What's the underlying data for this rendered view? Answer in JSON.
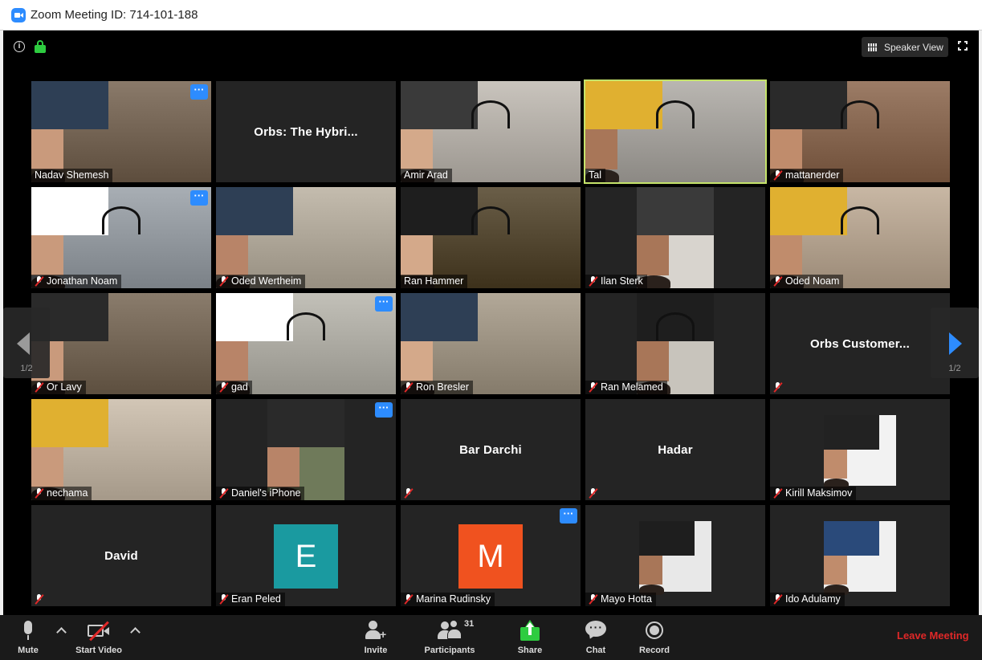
{
  "window": {
    "title": "Zoom Meeting ID: 714-101-188"
  },
  "top_bar": {
    "speaker_view_label": "Speaker View"
  },
  "nav": {
    "prev_page": "1/2",
    "next_page": "1/2"
  },
  "toolbar": {
    "mute_label": "Mute",
    "start_video_label": "Start Video",
    "invite_label": "Invite",
    "participants_label": "Participants",
    "participants_count": "31",
    "share_label": "Share",
    "chat_label": "Chat",
    "record_label": "Record",
    "leave_label": "Leave Meeting"
  },
  "tiles": [
    {
      "name": "Nadav Shemesh",
      "muted": false,
      "more": true,
      "kind": "video",
      "bg": "#8a7a6a"
    },
    {
      "name": "",
      "center": "Orbs:  The  Hybri...",
      "muted": false,
      "kind": "text"
    },
    {
      "name": "Amir Arad",
      "muted": false,
      "kind": "video",
      "bg": "#c9c4bd"
    },
    {
      "name": "Tal",
      "muted": false,
      "active": true,
      "kind": "video",
      "bg": "#b9b6b1"
    },
    {
      "name": "mattanerder",
      "muted": true,
      "kind": "video",
      "bg": "#9c7c66"
    },
    {
      "name": "Jonathan Noam",
      "muted": true,
      "more": true,
      "kind": "video",
      "bg": "#a8aeb4"
    },
    {
      "name": "Oded Wertheim",
      "muted": true,
      "kind": "video",
      "bg": "#c4bcae"
    },
    {
      "name": "Ran Hammer",
      "muted": false,
      "kind": "video",
      "bg": "#6a5e48"
    },
    {
      "name": "Ilan Sterk",
      "muted": true,
      "kind": "video",
      "bg": "#d8d4ce",
      "pillar": true
    },
    {
      "name": "Oded Noam",
      "muted": true,
      "kind": "video",
      "bg": "#c8b7a4"
    },
    {
      "name": "Or Lavy",
      "muted": true,
      "kind": "video",
      "bg": "#8a7c6c"
    },
    {
      "name": "gad",
      "muted": true,
      "more": true,
      "kind": "video",
      "bg": "#c2c0b8"
    },
    {
      "name": "Ron Bresler",
      "muted": true,
      "kind": "video",
      "bg": "#b2a898"
    },
    {
      "name": "Ran Melamed",
      "muted": true,
      "kind": "video",
      "bg": "#c8c4bc",
      "pillar": true
    },
    {
      "name": "",
      "center": "Orbs  Customer...",
      "muted": true,
      "kind": "text"
    },
    {
      "name": "nechama",
      "muted": true,
      "kind": "video",
      "bg": "#d2c6b6"
    },
    {
      "name": "Daniel's iPhone",
      "muted": true,
      "more": true,
      "kind": "video",
      "bg": "#6f7a5a",
      "pillar": true
    },
    {
      "name": "",
      "center": "Bar Darchi",
      "muted": true,
      "kind": "text"
    },
    {
      "name": "",
      "center": "Hadar",
      "muted": true,
      "kind": "text"
    },
    {
      "name": "Kirill Maksimov",
      "muted": true,
      "kind": "photo",
      "bg": "#f2f2f2"
    },
    {
      "name": "",
      "center": "David",
      "muted": true,
      "kind": "text"
    },
    {
      "name": "Eran Peled",
      "muted": true,
      "kind": "avatar",
      "letter": "E",
      "color": "#1a9aa0"
    },
    {
      "name": "Marina Rudinsky",
      "muted": true,
      "more": true,
      "kind": "avatar",
      "letter": "M",
      "color": "#f0521f"
    },
    {
      "name": "Mayo Hotta",
      "muted": true,
      "kind": "photo",
      "bg": "#e8e8e8"
    },
    {
      "name": "Ido Adulamy",
      "muted": true,
      "kind": "photo",
      "bg": "#f0f0f0"
    }
  ],
  "colors": {
    "accent": "#2d8cff",
    "active_outline": "#c5e36a",
    "leave": "#e02828",
    "share": "#2ecc40"
  }
}
